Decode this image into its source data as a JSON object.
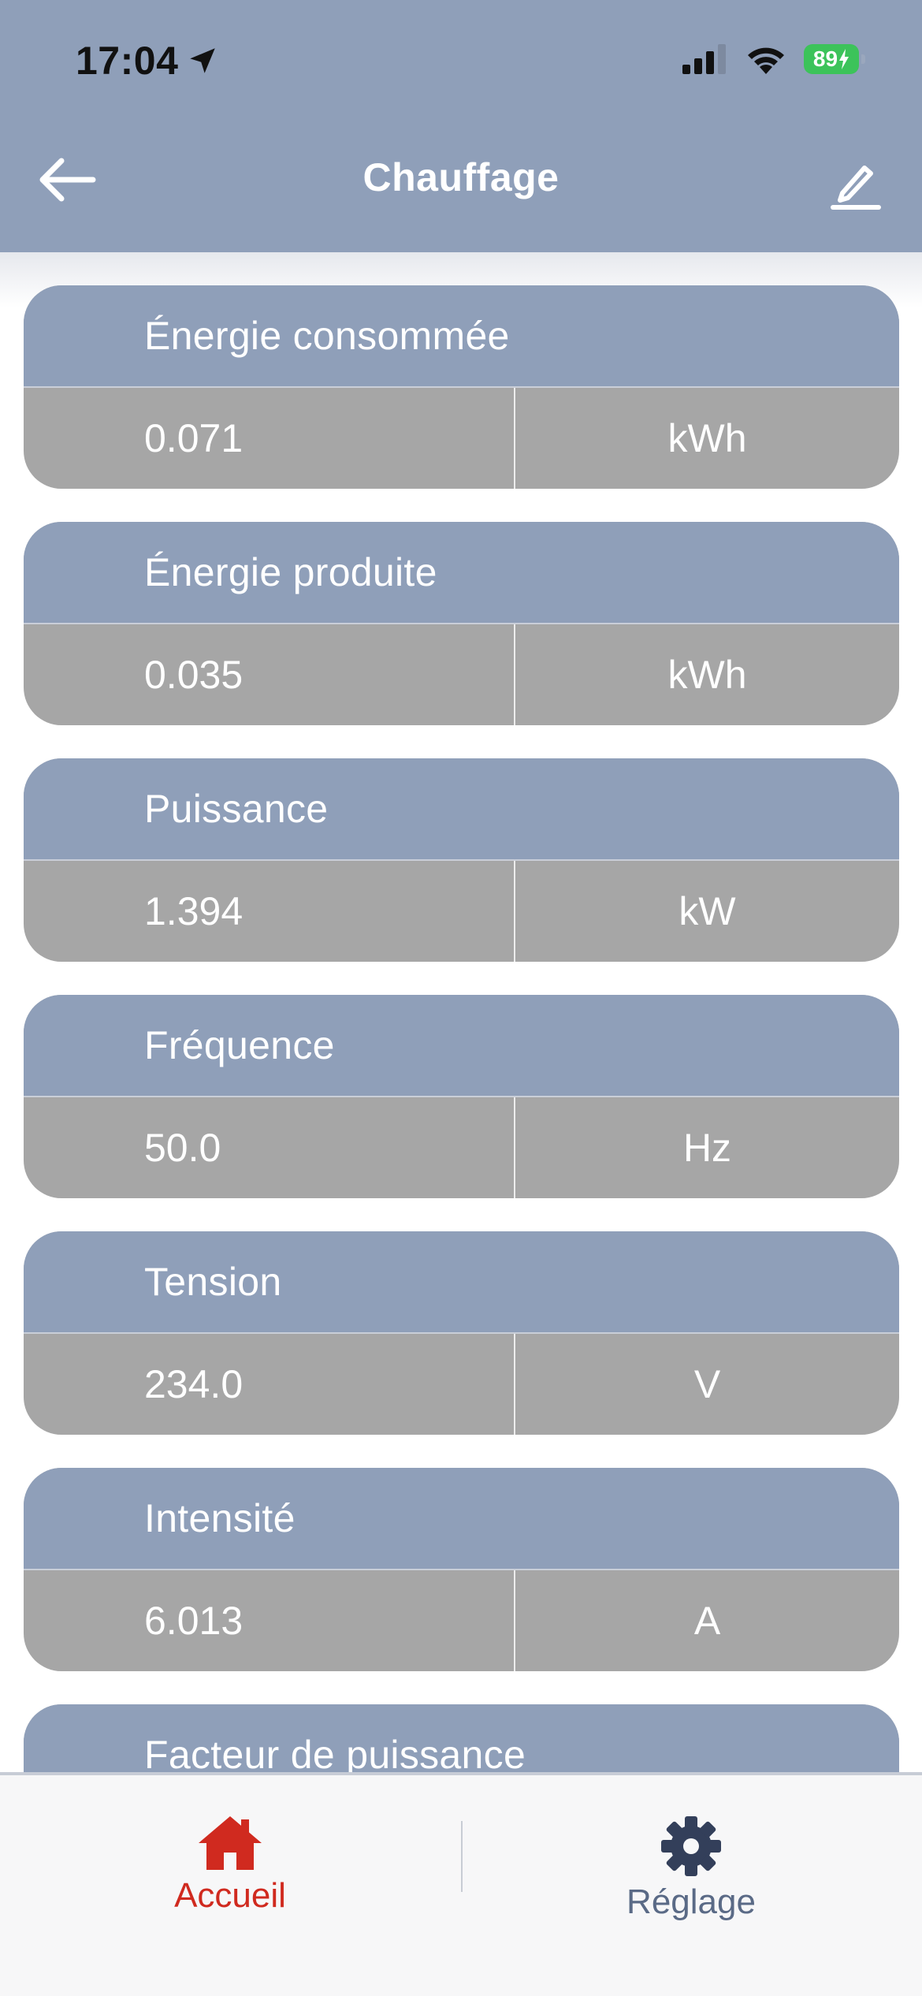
{
  "status_bar": {
    "time": "17:04",
    "battery": "89"
  },
  "header": {
    "title": "Chauffage"
  },
  "measurements": [
    {
      "label": "Énergie consommée",
      "value": "0.071",
      "unit": "kWh"
    },
    {
      "label": "Énergie produite",
      "value": "0.035",
      "unit": "kWh"
    },
    {
      "label": "Puissance",
      "value": "1.394",
      "unit": "kW"
    },
    {
      "label": "Fréquence",
      "value": "50.0",
      "unit": "Hz"
    },
    {
      "label": "Tension",
      "value": "234.0",
      "unit": "V"
    },
    {
      "label": "Intensité",
      "value": "6.013",
      "unit": "A"
    },
    {
      "label": "Facteur de puissance"
    }
  ],
  "tab_bar": {
    "home_label": "Accueil",
    "settings_label": "Réglage"
  },
  "colors": {
    "header_blue": "#8f9fb9",
    "card_gray": "#a6a6a6",
    "active_tab_red": "#d02a1f",
    "inactive_tab_slate": "#5a6a86",
    "battery_green": "#3cc35a"
  },
  "icons": {
    "location": "location-arrow-icon",
    "signal": "cellular-signal-icon",
    "wifi": "wifi-icon",
    "back": "arrow-left-icon",
    "edit": "pencil-icon",
    "home": "home-icon",
    "settings": "gear-icon"
  }
}
